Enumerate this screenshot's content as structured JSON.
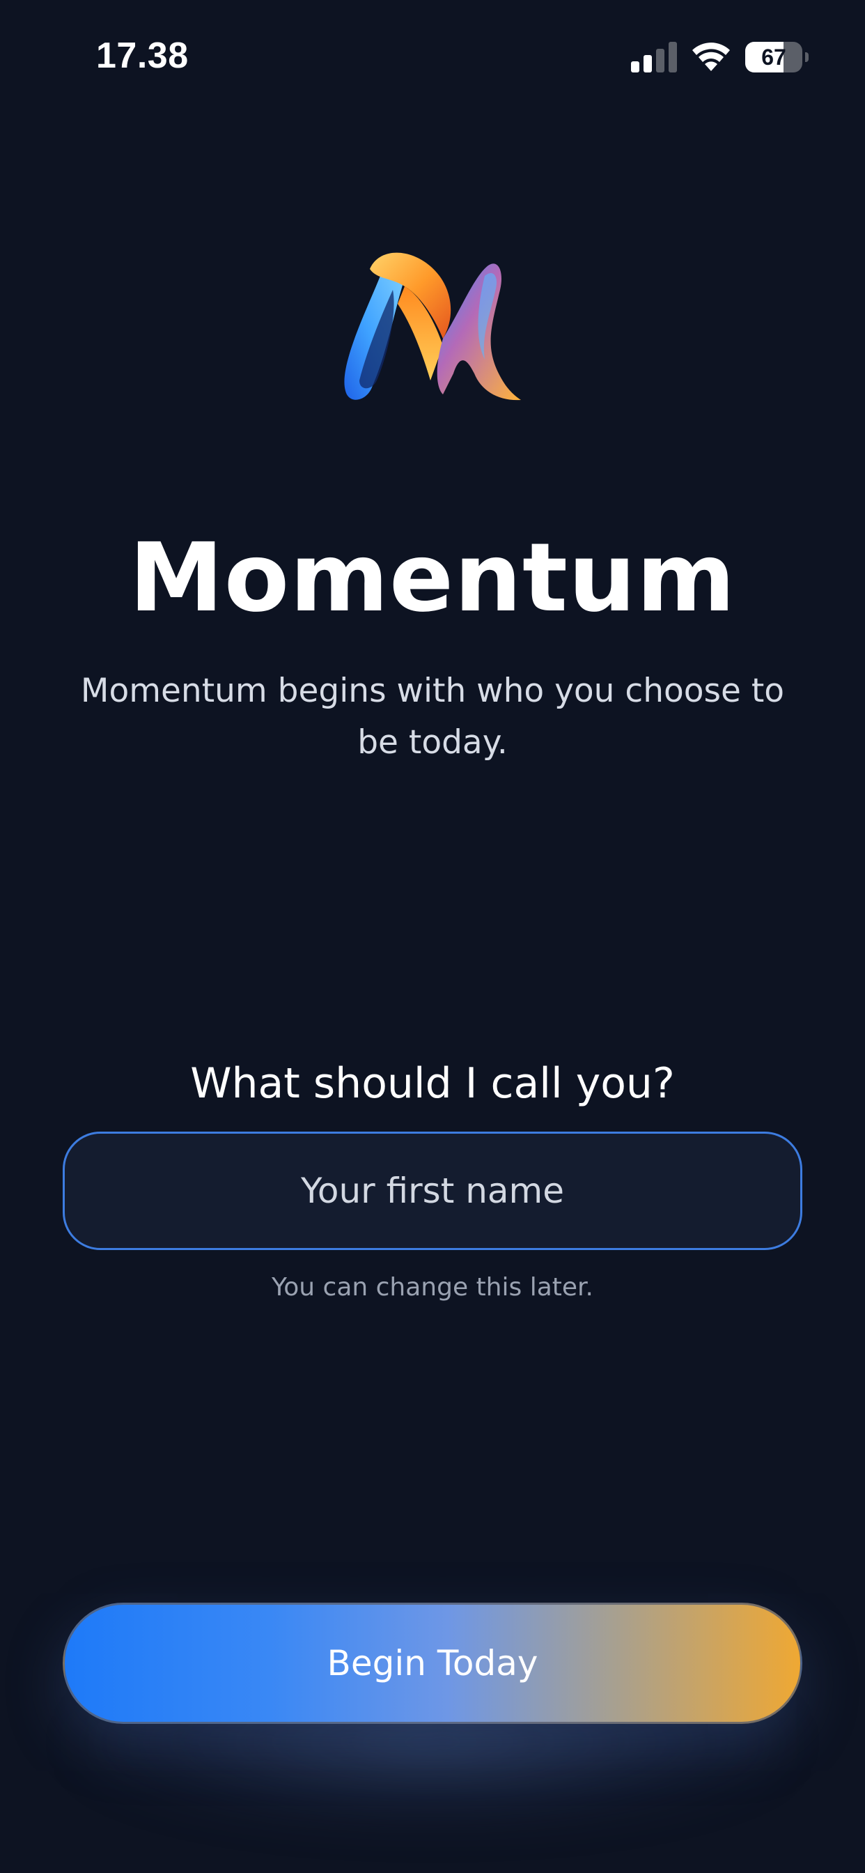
{
  "status_bar": {
    "time": "17.38",
    "battery_percent": 67,
    "battery_label": "67",
    "icons": [
      "signal-icon",
      "wifi-icon",
      "battery-icon"
    ]
  },
  "branding": {
    "logo_icon": "momentum-m-ribbon-logo",
    "title": "Momentum",
    "tagline": "Momentum begins with who you choose to be today."
  },
  "name_prompt": {
    "question": "What should I call you?",
    "placeholder": "Your first name",
    "value": "",
    "hint": "You can change this later."
  },
  "actions": {
    "begin_label": "Begin Today"
  },
  "colors": {
    "background": "#0d1322",
    "input_border": "#3d7ce0",
    "cta_gradient_start": "#1e7af8",
    "cta_gradient_end": "#efa833"
  }
}
